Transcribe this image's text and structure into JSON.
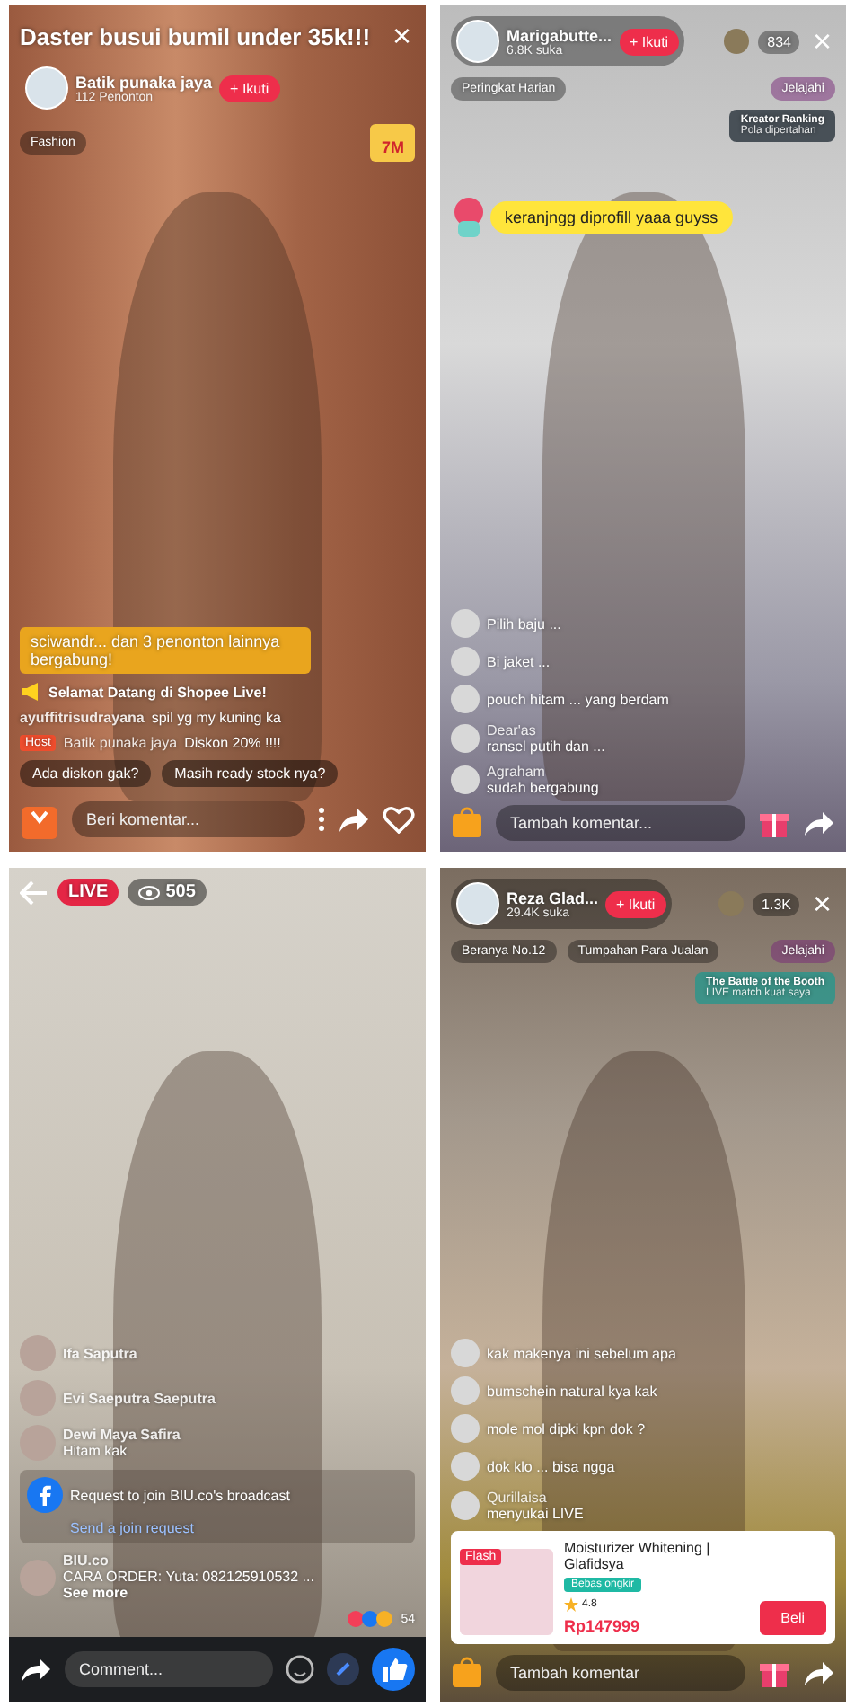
{
  "panels": [
    {
      "kind": "shopee",
      "title": "Daster busui bumil under 35k!!!",
      "close": "×",
      "host": {
        "name": "Batik punaka jaya",
        "sub": "112 Penonton",
        "follow": "+ Ikuti"
      },
      "tags": [
        "Fashion"
      ],
      "side_badge": "7M",
      "comments": [
        {
          "kind": "highlight",
          "text": "sciwandr... dan 3 penonton lainnya bergabung!"
        },
        {
          "kind": "system",
          "text": "Selamat Datang di Shopee Live!"
        },
        {
          "kind": "chat",
          "user": "ayuffitrisudrayana",
          "text": "spil yg my kuning ka"
        },
        {
          "kind": "host",
          "badge": "Host",
          "user": "Batik punaka jaya",
          "text": "Diskon 20% !!!!"
        }
      ],
      "chips": [
        "Ada diskon gak?",
        "Masih ready stock nya?"
      ],
      "input": {
        "placeholder": "Beri komentar..."
      }
    },
    {
      "kind": "tiktok",
      "close": "×",
      "host": {
        "name": "Marigabutte...",
        "sub": "6.8K suka",
        "follow": "+ Ikuti"
      },
      "viewers": "834",
      "tags": [
        "Peringkat Harian"
      ],
      "right_tag": "Jelajahi",
      "banner": {
        "title": "Kreator Ranking",
        "sub": "Pola dipertahan"
      },
      "pinned": "keranjngg diprofill yaaa guyss",
      "comments": [
        {
          "kind": "chat",
          "text": "Pilih baju ..."
        },
        {
          "kind": "chat",
          "text": "Bi jaket ..."
        },
        {
          "kind": "chat",
          "text": "pouch hitam ... yang berdam"
        },
        {
          "kind": "chat",
          "user": "Dear'as",
          "text": "ransel putih dan ..."
        },
        {
          "kind": "chat",
          "user": "Agraham",
          "text": "sudah bergabung"
        }
      ],
      "input": {
        "placeholder": "Tambah komentar..."
      }
    },
    {
      "kind": "facebook",
      "live": "LIVE",
      "viewers": "505",
      "comments": [
        {
          "kind": "chat",
          "user": "Ifa Saputra"
        },
        {
          "kind": "chat",
          "user": "Evi Saeputra Saeputra"
        },
        {
          "kind": "chat",
          "user": "Dewi Maya Safira",
          "text": "Hitam kak"
        },
        {
          "kind": "request",
          "text": "Request to join BIU.co's broadcast",
          "link": "Send a join request"
        },
        {
          "kind": "chat",
          "user": "BIU.co",
          "text": "CARA ORDER: Yuta: 082125910532 ...",
          "more": "See more"
        }
      ],
      "reactions": "54",
      "input": {
        "placeholder": "Comment..."
      }
    },
    {
      "kind": "tiktok",
      "close": "×",
      "host": {
        "name": "Reza Glad...",
        "sub": "29.4K suka",
        "follow": "+ Ikuti"
      },
      "viewers": "1.3K",
      "tags": [
        "Beranya No.12",
        "Tumpahan Para Jualan"
      ],
      "right_tag": "Jelajahi",
      "banner": {
        "title": "The Battle of the Booth",
        "sub": "LIVE match kuat saya"
      },
      "comments": [
        {
          "kind": "chat",
          "text": "kak makenya ini sebelum apa"
        },
        {
          "kind": "chat",
          "text": "bumschein natural kya kak"
        },
        {
          "kind": "chat",
          "text": "mole mol dipki kpn dok ?"
        },
        {
          "kind": "chat",
          "text": "dok klo ... bisa ngga"
        },
        {
          "kind": "chat",
          "user": "Qurillaisa",
          "text": "menyukai LIVE"
        }
      ],
      "product": {
        "tag": "Flash",
        "name": "Moisturizer Whitening | Glafidsya",
        "badge": "Bebas ongkir",
        "rating": "4.8",
        "price": "Rp147999",
        "buy": "Beli"
      },
      "input": {
        "placeholder": "Tambah komentar"
      }
    }
  ]
}
